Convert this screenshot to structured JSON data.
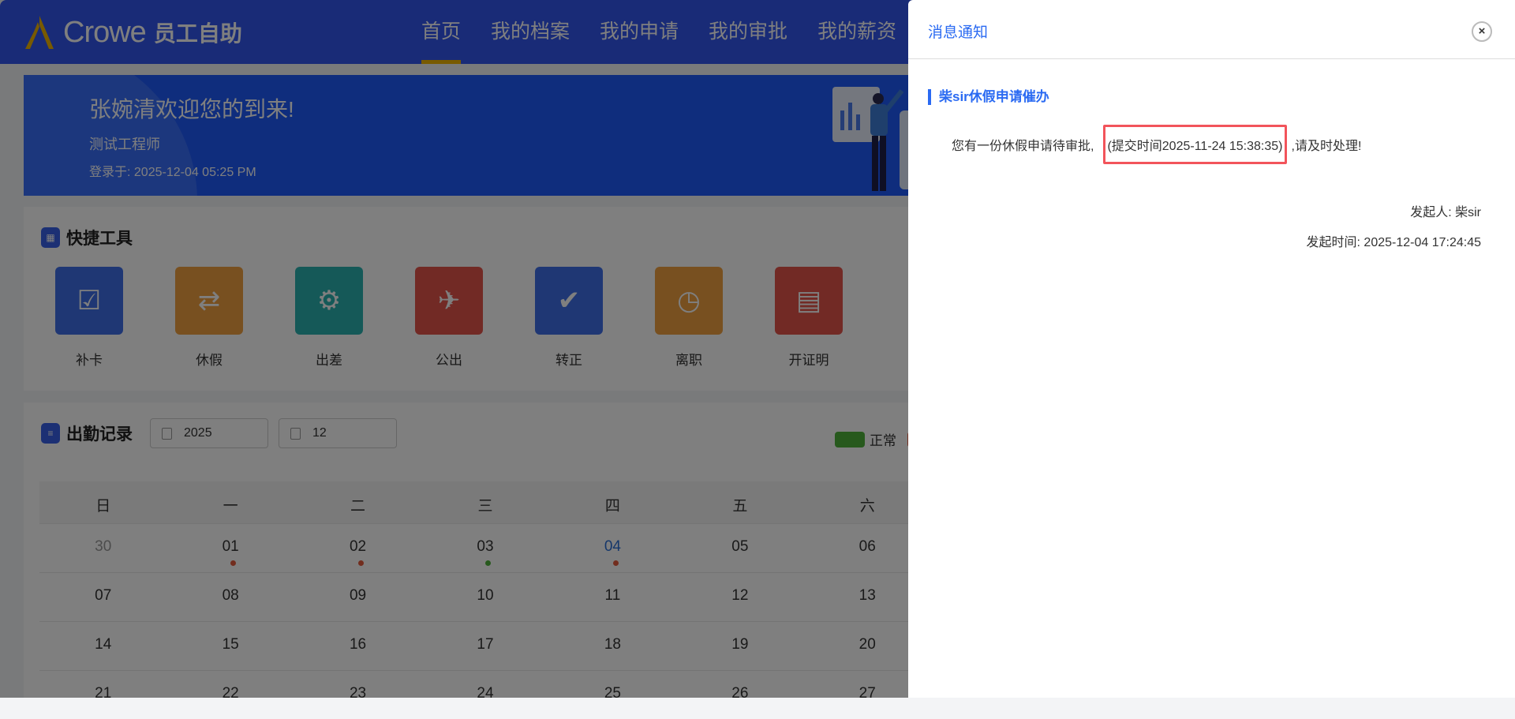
{
  "header": {
    "brand": "Crowe",
    "app_name": "员工自助",
    "nav": [
      "首页",
      "我的档案",
      "我的申请",
      "我的审批",
      "我的薪资"
    ]
  },
  "banner": {
    "welcome": "张婉清欢迎您的到来!",
    "role": "测试工程师",
    "login": "登录于: 2025-12-04 05:25 PM"
  },
  "quick_tools": {
    "title": "快捷工具",
    "items": [
      {
        "label": "补卡",
        "icon": "calendar-check-icon",
        "color": "#3f6ee8"
      },
      {
        "label": "休假",
        "icon": "swap-box-icon",
        "color": "#f0a040"
      },
      {
        "label": "出差",
        "icon": "briefcase-gear-icon",
        "color": "#2bb3b0"
      },
      {
        "label": "公出",
        "icon": "suitcase-icon",
        "color": "#e5544a"
      },
      {
        "label": "转正",
        "icon": "user-check-icon",
        "color": "#3f6ee8"
      },
      {
        "label": "离职",
        "icon": "user-clock-icon",
        "color": "#f0a040"
      },
      {
        "label": "开证明",
        "icon": "certificate-icon",
        "color": "#e5544a"
      }
    ]
  },
  "attendance": {
    "title": "出勤记录",
    "year": "2025",
    "month": "12",
    "legend": [
      "正常"
    ],
    "weekdays": [
      "日",
      "一",
      "二",
      "三",
      "四",
      "五",
      "六"
    ],
    "weeks": [
      [
        "30",
        "01",
        "02",
        "03",
        "04",
        "05",
        "06"
      ],
      [
        "07",
        "08",
        "09",
        "10",
        "11",
        "12",
        "13"
      ],
      [
        "14",
        "15",
        "16",
        "17",
        "18",
        "19",
        "20"
      ],
      [
        "21",
        "22",
        "23",
        "24",
        "25",
        "26",
        "27"
      ]
    ],
    "dots": {
      "01": "#e45a3c",
      "02": "#e45a3c",
      "03": "#4fb33a",
      "04": "#e45a3c"
    }
  },
  "panel": {
    "title": "消息通知",
    "message_title": "柴sir休假申请催办",
    "body_prefix": "您有一份休假申请待审批,",
    "body_highlight": "(提交时间2025-11-24 15:38:35)",
    "body_suffix": ",请及时处理!",
    "initiator": "发起人: 柴sir",
    "initiated_time": "发起时间: 2025-12-04 17:24:45"
  }
}
